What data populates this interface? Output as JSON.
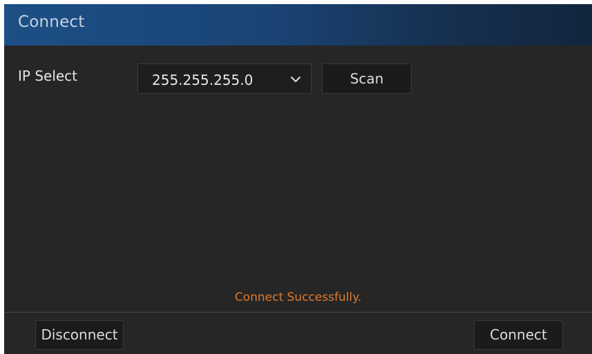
{
  "window": {
    "title": "Connect"
  },
  "ip_select": {
    "label": "IP Select",
    "value": "255.255.255.0",
    "icon": "chevron-down-icon"
  },
  "buttons": {
    "scan": "Scan",
    "disconnect": "Disconnect",
    "connect": "Connect"
  },
  "status": {
    "message": "Connect Successfully.",
    "color": "#e07a2c"
  },
  "colors": {
    "title_bar": "#1c4f86",
    "background": "#262626"
  }
}
